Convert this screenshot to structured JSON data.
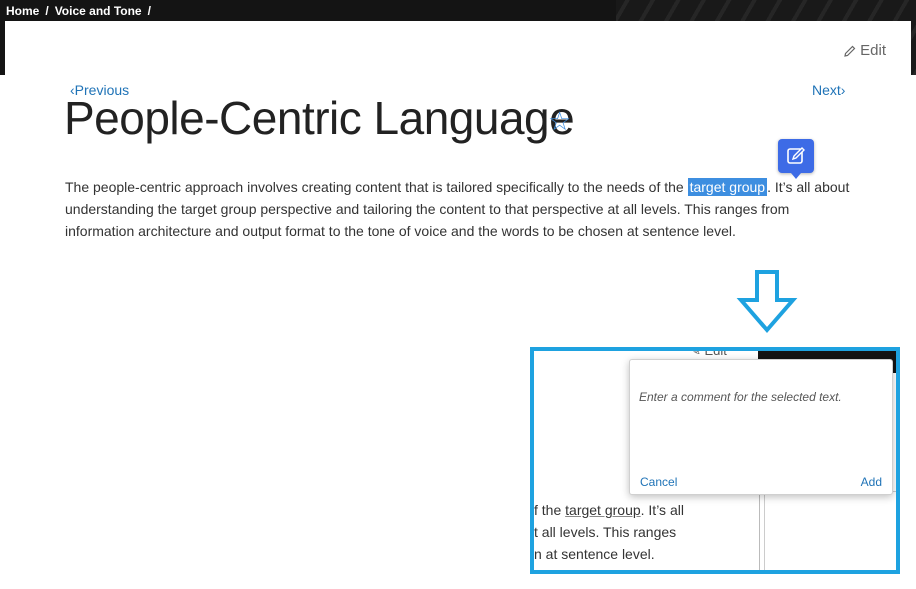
{
  "breadcrumb": {
    "items": [
      "Home",
      "Voice and Tone"
    ],
    "separator": "/"
  },
  "header": {
    "edit_label": "Edit"
  },
  "nav": {
    "previous_label": "Previous",
    "next_label": "Next"
  },
  "page": {
    "title": "People-Centric Language",
    "star_icon": "star-outline-icon",
    "paragraph_before": "The people-centric approach involves creating content that is tailored specifically to the needs of the ",
    "highlighted": "target group",
    "paragraph_after": ". It’s all about understanding the target group perspective and tailoring the content to that perspective at all levels. This ranges from information architecture and output format to the tone of voice and the words to be chosen at sentence level."
  },
  "comment_button": {
    "icon": "add-comment-icon"
  },
  "inset": {
    "edit_label": "Edit",
    "line1_prefix": "f the ",
    "line1_target": "target group",
    "line1_suffix": ". It’s all",
    "line2": "t all levels. This ranges",
    "line3": "n at sentence level.",
    "popup": {
      "placeholder": "Enter a comment for the selected text.",
      "cancel_label": "Cancel",
      "add_label": "Add"
    }
  },
  "colors": {
    "accent": "#3d8ee0",
    "link": "#1f73b7",
    "inset_border": "#1ea2e0",
    "button": "#3d6be6"
  }
}
